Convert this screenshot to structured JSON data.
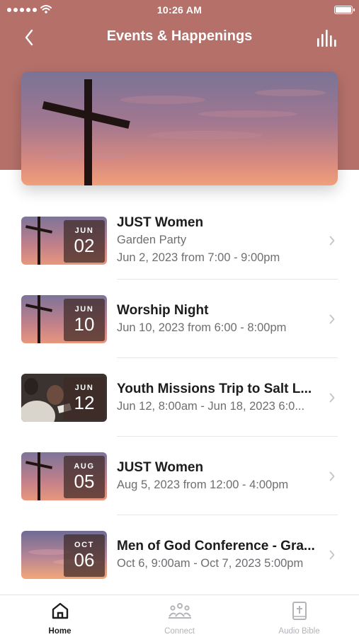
{
  "status_bar": {
    "time": "10:26 AM"
  },
  "nav": {
    "title": "Events & Happenings",
    "back_icon": "chevron-left-icon",
    "right_icon": "bar-chart-icon"
  },
  "hero": {
    "image": "cross-against-sunset-sky"
  },
  "events": [
    {
      "month": "JUN",
      "day": "02",
      "title": "JUST Women",
      "lines": [
        "Garden Party",
        "Jun 2, 2023 from 7:00 - 9:00pm"
      ],
      "thumb": "cross"
    },
    {
      "month": "JUN",
      "day": "10",
      "title": "Worship Night",
      "lines": [
        "Jun 10, 2023 from 6:00 - 8:00pm"
      ],
      "thumb": "cross"
    },
    {
      "month": "JUN",
      "day": "12",
      "title": "Youth Missions Trip to Salt L...",
      "lines": [
        "Jun 12, 8:00am - Jun 18, 2023 6:0..."
      ],
      "thumb": "people"
    },
    {
      "month": "AUG",
      "day": "05",
      "title": "JUST Women",
      "lines": [
        "Aug 5, 2023 from 12:00 - 4:00pm"
      ],
      "thumb": "cross"
    },
    {
      "month": "OCT",
      "day": "06",
      "title": "Men of God Conference - Gra...",
      "lines": [
        "Oct 6, 9:00am - Oct 7, 2023 5:00pm"
      ],
      "thumb": "sky"
    }
  ],
  "tabs": [
    {
      "label": "Home",
      "icon": "home-icon",
      "active": true
    },
    {
      "label": "Connect",
      "icon": "people-icon",
      "active": false
    },
    {
      "label": "Audio Bible",
      "icon": "bible-icon",
      "active": false
    }
  ],
  "colors": {
    "header": "#b5706a",
    "active_tab": "#1c1c1e",
    "inactive_tab": "#b3b3b8"
  }
}
